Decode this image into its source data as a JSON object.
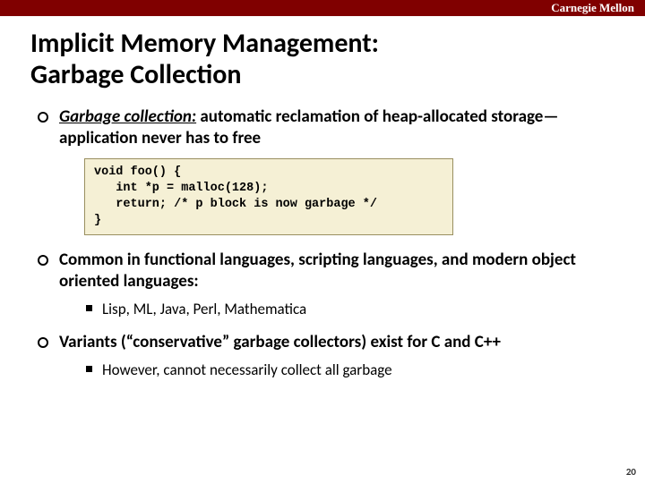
{
  "header": {
    "brand": "Carnegie Mellon"
  },
  "title_line1": "Implicit Memory Management:",
  "title_line2": "Garbage Collection",
  "bullet1": {
    "term": "Garbage collection:",
    "rest": " automatic reclamation of heap-allocated storage—application never has to free"
  },
  "code": "void foo() {\n   int *p = malloc(128);\n   return; /* p block is now garbage */\n}",
  "bullet2": {
    "text": "Common in functional languages, scripting languages, and modern object oriented languages:",
    "sub1": "Lisp, ML, Java, Perl, Mathematica"
  },
  "bullet3": {
    "text": "Variants (“conservative” garbage collectors) exist for C and C++",
    "sub1": "However, cannot necessarily collect all garbage"
  },
  "page_number": "20"
}
